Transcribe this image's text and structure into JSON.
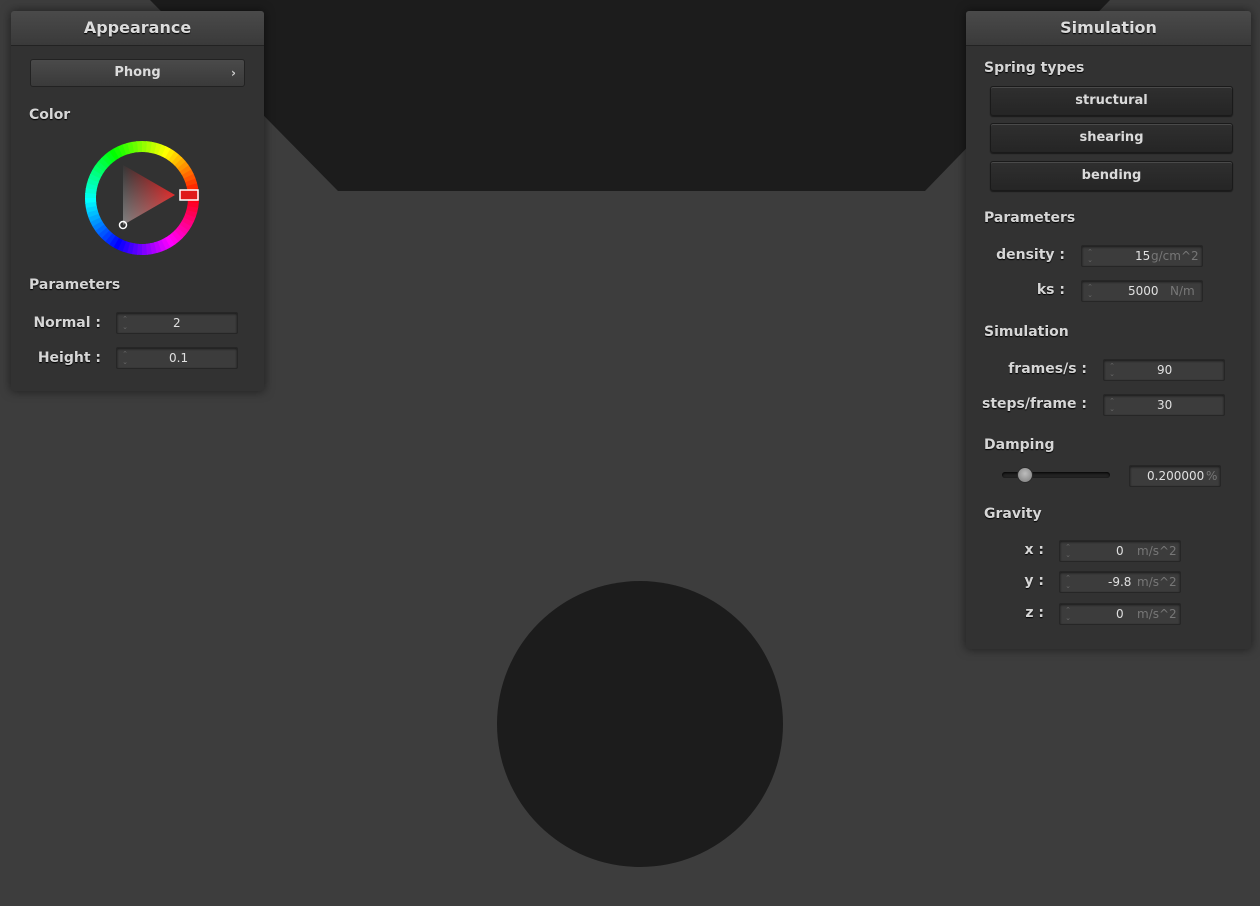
{
  "colors": {
    "viewport_bg": "#3d3d3d",
    "scene_object": "#1c1c1c",
    "panel_bg": "#323232",
    "selected_color": "#e01a1a"
  },
  "appearance": {
    "title": "Appearance",
    "shader_label": "Phong",
    "color_label": "Color",
    "params_label": "Parameters",
    "normal_label": "Normal :",
    "normal_value": "2",
    "height_label": "Height :",
    "height_value": "0.1"
  },
  "simulation": {
    "title": "Simulation",
    "spring_types_label": "Spring types",
    "spring_buttons": [
      "structural",
      "shearing",
      "bending"
    ],
    "params_label": "Parameters",
    "density_label": "density :",
    "density_value": "15",
    "density_unit": "g/cm^2",
    "ks_label": "ks :",
    "ks_value": "5000",
    "ks_unit": "N/m",
    "sim_label": "Simulation",
    "fps_label": "frames/s :",
    "fps_value": "90",
    "steps_label": "steps/frame :",
    "steps_value": "30",
    "damping_label": "Damping",
    "damping_value": "0.200000",
    "damping_unit": "%",
    "damping_fraction": 0.2,
    "gravity_label": "Gravity",
    "gx_label": "x :",
    "gx_value": "0",
    "gy_label": "y :",
    "gy_value": "-9.8",
    "gz_label": "z :",
    "gz_value": "0",
    "gravity_unit": "m/s^2"
  }
}
